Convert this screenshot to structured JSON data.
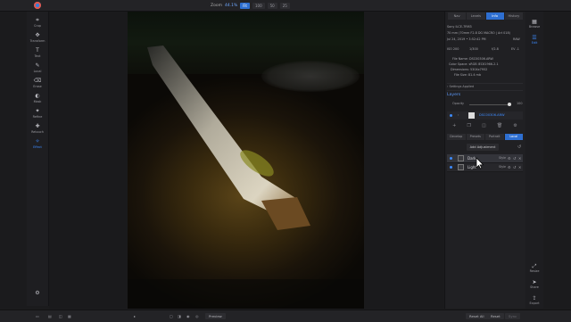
{
  "topbar": {
    "zoom_label": "Zoom",
    "zoom_value": "44.1%",
    "zoom_buttons": [
      "Fit",
      "100",
      "50",
      "25"
    ],
    "active_zoom": "Fit"
  },
  "tools": [
    {
      "label": "Crop",
      "icon": "crop-icon"
    },
    {
      "label": "Transform",
      "icon": "transform-icon"
    },
    {
      "label": "Text",
      "icon": "text-icon"
    },
    {
      "label": "Local",
      "icon": "local-brush-icon"
    },
    {
      "label": "Erase",
      "icon": "erase-icon"
    },
    {
      "label": "Mask",
      "icon": "mask-icon"
    },
    {
      "label": "Refine",
      "icon": "refine-icon"
    },
    {
      "label": "Retouch",
      "icon": "retouch-icon"
    },
    {
      "label": "Effect",
      "icon": "effect-icon"
    }
  ],
  "right_tabs": [
    "Nav",
    "Levels",
    "Info",
    "History"
  ],
  "active_right_tab": "Info",
  "info": {
    "camera": "Sony ILCE-7RM3",
    "lens": "70 mm (70mm F2.8 DG MACRO | Art 018)",
    "date": "Jul 24, 2019 • 3:52:42 PM",
    "format": "RAW",
    "iso": "ISO 200",
    "shutter": "1/300",
    "aperture": "f/2.8",
    "ev": "EV -1",
    "file_name": "File Name: DSC00306.ARW",
    "color_space": "Color Space: sRGB IEC61966-2.1",
    "dimensions": "Dimensions: 5304x7952",
    "file_size": "File Size: 81.4 mb"
  },
  "settings_label": "Settings Applied",
  "layers": {
    "title": "Layers",
    "opacity_label": "Opacity",
    "opacity_value": "100",
    "layer_name": "DSC00306.ARW"
  },
  "sub_tabs": [
    "Develop",
    "Presets",
    "Portrait",
    "Local"
  ],
  "active_sub_tab": "Local",
  "add_adjustment": "Add Adjustment",
  "adjustments": [
    {
      "name": "Dark",
      "style": "Style"
    },
    {
      "name": "Light",
      "style": "Style"
    }
  ],
  "far_right": [
    "Browse",
    "Edit",
    "Resize",
    "Share",
    "Export"
  ],
  "bottom": {
    "preview": "Preview",
    "reset_all": "Reset All",
    "reset": "Reset",
    "sync": "Sync"
  }
}
